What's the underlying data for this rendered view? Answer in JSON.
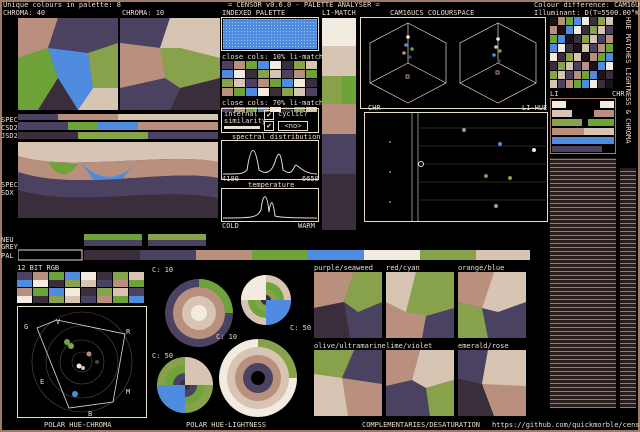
{
  "header": {
    "unique": "Unique colours in palette: 8",
    "title": "= CENSOR v0.6.0 - PALETTE ANALYSER =",
    "diff": "Colour difference: CAM16UCS",
    "illum": "Illuminant: D(T=5500.00°K)"
  },
  "labels": {
    "chroma40": "CHROMA: 40",
    "chroma10": "CHROMA: 10",
    "indexed": "INDEXED PALETTE",
    "limatch": "LI-MATCH",
    "cam": "CAM16UCS COLOURSPACE",
    "close10": "close cols: 10% li-match",
    "close70": "close cols: 70% li-match",
    "internal": "internal",
    "similarity": "similarity",
    "cyclic": "cyclic?",
    "no": "<no>",
    "spectral": "spectral distribution",
    "s4100": "4100",
    "s6650": "6650",
    "temp": "temperature",
    "cold": "COLD",
    "warm": "WARM",
    "spec": "SPEC",
    "csd2": "CSD2",
    "jsd2": "JSD2",
    "spec2": "SPEC",
    "sdx": "SDX",
    "neu": "NEU",
    "grey": "GREY",
    "pal": "PAL",
    "chr": "CHR",
    "lihue": "LI-HUE",
    "li": "LI",
    "chr2": "CHR",
    "side": "HUE MATCHES LIGHTNESS & CHROMA",
    "bit12": "12 BIT RGB",
    "c10a": "C: 10",
    "c50a": "C: 50",
    "c50b": "C: 50",
    "c10b": "C: 10",
    "pg": "G",
    "pv": "V",
    "pr": "R",
    "pe": "E",
    "pm": "M",
    "pb": "B",
    "purple": "purple/seaweed",
    "redcyan": "red/cyan",
    "orangeblue": "orange/blue",
    "oliveultra": "olive/ultramarine",
    "limeviolet": "lime/violet",
    "emerald": "emerald/rose",
    "f1": "POLAR HUE-CHROMA",
    "f2": "POLAR HUE-LIGHTNESS",
    "f3": "COMPLEMENTARIES/DESATURATION",
    "f4": "https://github.com/quickmorble/censor"
  },
  "palette": [
    "#4a4260",
    "#b9907e",
    "#6ea33a",
    "#4f8ce0",
    "#f2ece0",
    "#3a2e3c",
    "#87a24a",
    "#d8c4b2"
  ],
  "colors": {
    "bg": "#000000",
    "fg": "#e8dccc",
    "frame": "#a07a64",
    "dark": "#1a1418"
  }
}
